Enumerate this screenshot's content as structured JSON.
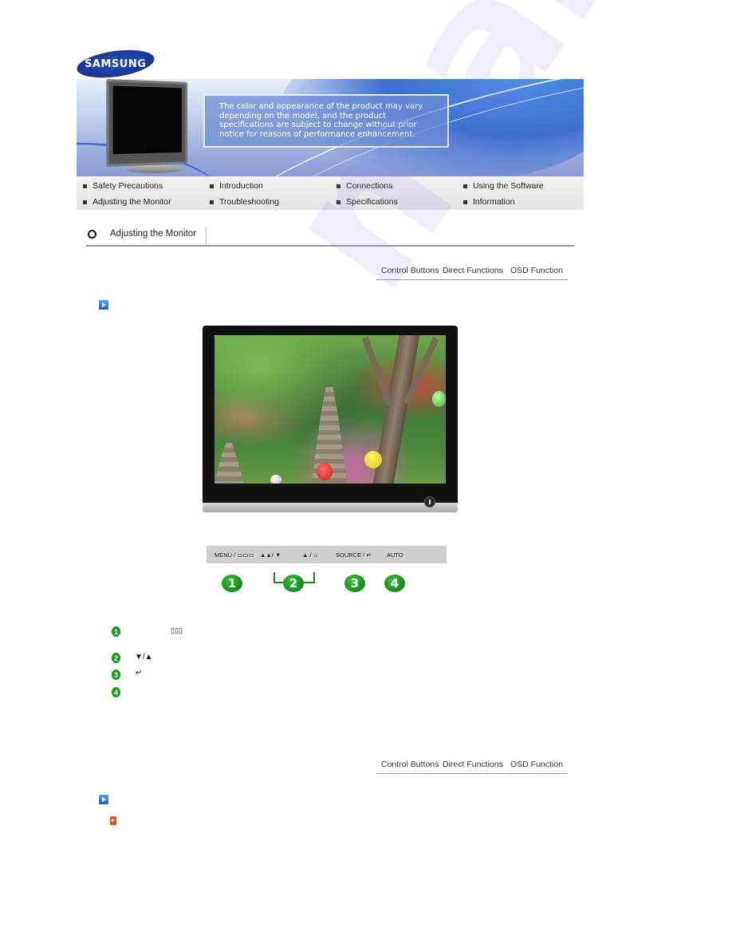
{
  "brand": {
    "logo_text": "SAMSUNG"
  },
  "banner": {
    "notice": "The color and appearance of the product may vary depending on the model, and the product specifications are subject to change without prior notice for reasons of performance enhancement."
  },
  "nav": {
    "items": [
      {
        "label": "Safety Precautions"
      },
      {
        "label": "Introduction"
      },
      {
        "label": "Connections"
      },
      {
        "label": "Using the Software"
      },
      {
        "label": "Adjusting the Monitor"
      },
      {
        "label": "Troubleshooting"
      },
      {
        "label": "Specifications"
      },
      {
        "label": "Information"
      }
    ]
  },
  "section": {
    "title": "Adjusting the Monitor"
  },
  "subnav": {
    "control_buttons": "Control Buttons",
    "direct_functions": "Direct Functions",
    "osd_function": "OSD Function"
  },
  "control_bar": {
    "labels": [
      "MENU / ▭▭▭",
      "▲▲/ ▼",
      "▲ / ☼",
      "SOURCE / ↵",
      "AUTO"
    ]
  },
  "callouts": [
    "1",
    "2",
    "3",
    "4"
  ],
  "legend": {
    "numbers": [
      "1",
      "2",
      "3",
      "4"
    ],
    "glyphs": [
      "▯▯▯",
      "▼/▲",
      "↵",
      ""
    ]
  },
  "colors": {
    "brand_blue": "#1a3a9c",
    "green_badge": "#1a9a1a",
    "arrow_blue": "#1f62c8",
    "arrow_orange": "#e0521a"
  },
  "watermark": "manualslib"
}
